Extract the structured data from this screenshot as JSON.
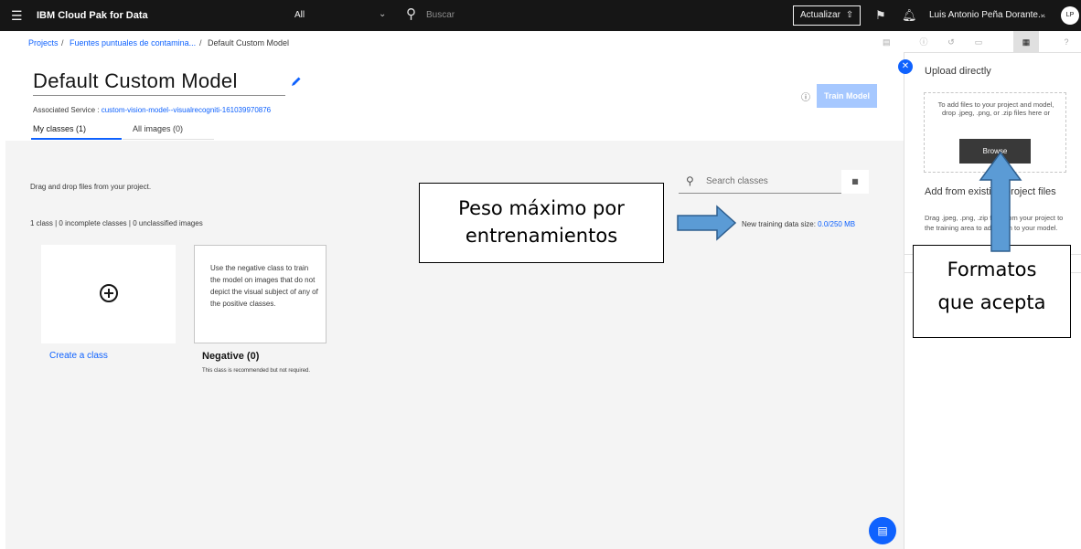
{
  "topbar": {
    "brand": "IBM Cloud Pak for Data",
    "scope": "All",
    "search_placeholder": "Buscar",
    "upgrade_label": "Actualizar",
    "user_name": "Luis Antonio Peña Dorante...",
    "avatar_initials": "LP"
  },
  "breadcrumb": {
    "items": [
      "Projects",
      "Fuentes puntuales de contamina...",
      "Default Custom Model"
    ],
    "separator": "/"
  },
  "header": {
    "title": "Default Custom Model",
    "associated_label": "Associated Service : ",
    "associated_service": "custom-vision-model--visualrecogniti-161039970876",
    "train_button": "Train Model"
  },
  "tabs": [
    {
      "label": "My classes (1)",
      "active": true
    },
    {
      "label": "All images (0)",
      "active": false
    }
  ],
  "main": {
    "drag_hint": "Drag and drop files from your project.",
    "summary": "1 class | 0 incomplete classes | 0 unclassified images",
    "search_placeholder": "Search classes",
    "size_label": "New training data size: ",
    "size_value": "0.0/250 MB",
    "create_class_label": "Create a class",
    "negative_card_text": "Use the negative class to train the model on images that do not depict the visual subject of any of the positive classes.",
    "negative_title": "Negative (0)",
    "negative_note": "This class is recommended but not required."
  },
  "panel": {
    "upload_title": "Upload directly",
    "drop_text": "To add files to your project and model, drop .jpeg, .png, or .zip files here or",
    "browse_label": "Browse",
    "add_title": "Add from existing project files",
    "add_text": "Drag .jpeg, .png, .zip files from your project to the training area to add them to your model."
  },
  "annotations": {
    "peso_line1": "Peso máximo por",
    "peso_line2": "entrenamientos",
    "formatos_line1": "Formatos",
    "formatos_line2": "que acepta"
  },
  "colors": {
    "topbar_bg": "#161616",
    "accent": "#0f62fe",
    "train_button_bg": "#a6c8ff",
    "arrow_fill": "#5b9bd5",
    "arrow_stroke": "#2e5e8e",
    "workspace_bg": "#f4f4f4"
  }
}
